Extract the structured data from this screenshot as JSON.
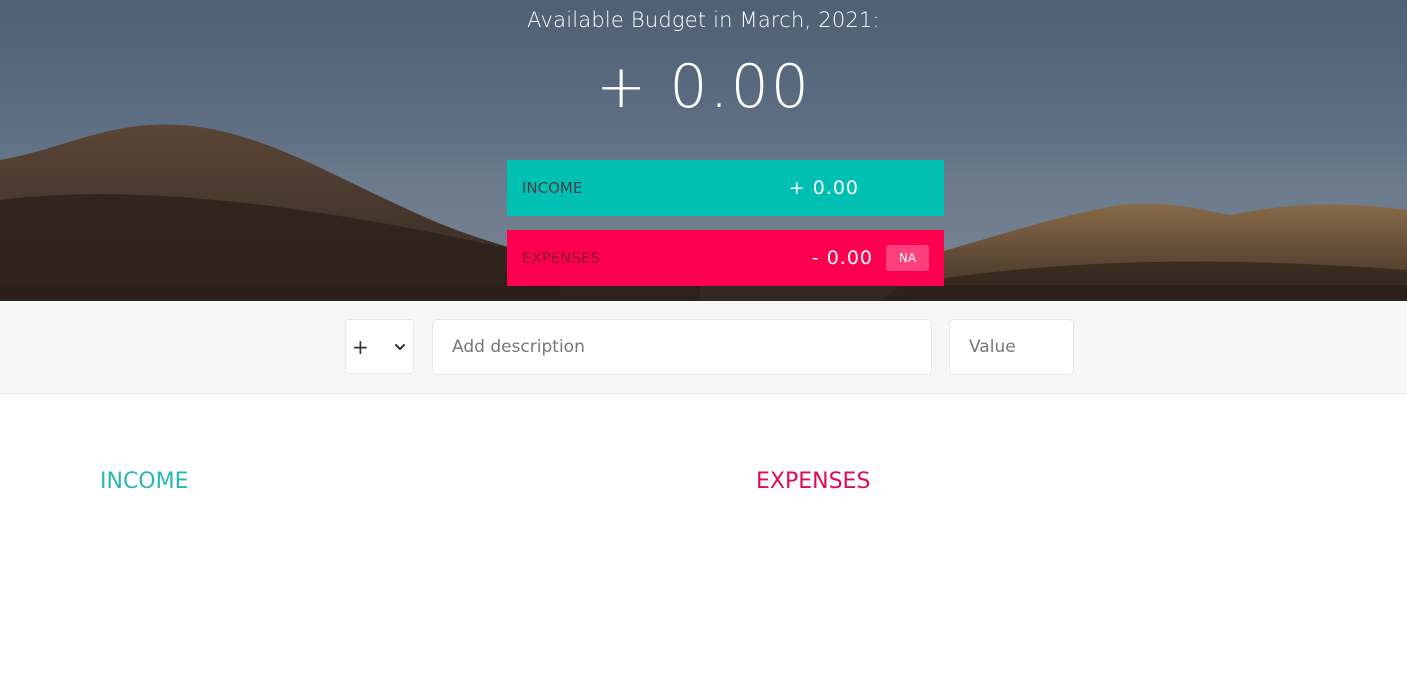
{
  "header": {
    "title": "Available Budget in March, 2021:",
    "budget_value": "+ 0.00"
  },
  "summary": {
    "income": {
      "label": "INCOME",
      "value": "+ 0.00"
    },
    "expenses": {
      "label": "EXPENSES",
      "value": "- 0.00",
      "percentage": "NA"
    }
  },
  "add_form": {
    "type_selected": "+",
    "type_options": [
      "+",
      "-"
    ],
    "description_placeholder": "Add description",
    "value_placeholder": "Value"
  },
  "lists": {
    "income_title": "INCOME",
    "expenses_title": "EXPENSES"
  },
  "colors": {
    "income": "#00c0b4",
    "expenses": "#ff0050",
    "income_text": "#28b9b5",
    "expenses_text": "#e00a5b"
  }
}
